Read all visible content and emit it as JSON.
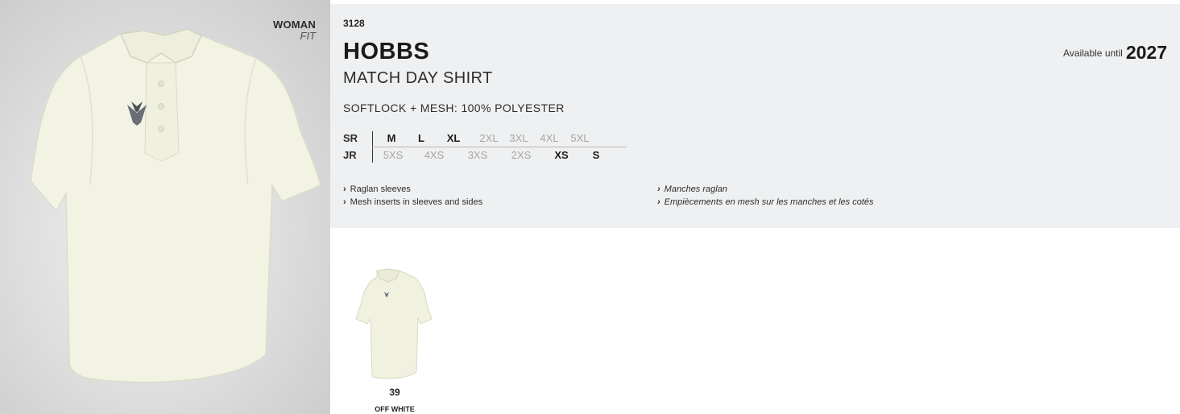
{
  "product": {
    "code": "3128",
    "name": "HOBBS",
    "subtitle": "MATCH DAY SHIRT",
    "material": "SOFTLOCK + MESH: 100% POLYESTER",
    "fit": {
      "gender": "WOMAN",
      "label": "FIT"
    },
    "availability": {
      "label": "Available until",
      "year": "2027"
    }
  },
  "sizes": {
    "senior": {
      "label": "SR",
      "items": [
        {
          "size": "M",
          "available": true
        },
        {
          "size": "L",
          "available": true
        },
        {
          "size": "XL",
          "available": true
        },
        {
          "size": "2XL",
          "available": false
        },
        {
          "size": "3XL",
          "available": false
        },
        {
          "size": "4XL",
          "available": false
        },
        {
          "size": "5XL",
          "available": false
        }
      ]
    },
    "junior": {
      "label": "JR",
      "items": [
        {
          "size": "5XS",
          "available": false
        },
        {
          "size": "4XS",
          "available": false
        },
        {
          "size": "3XS",
          "available": false
        },
        {
          "size": "2XS",
          "available": false
        },
        {
          "size": "XS",
          "available": true
        },
        {
          "size": "S",
          "available": true
        }
      ]
    }
  },
  "features": {
    "en": [
      "Raglan sleeves",
      "Mesh inserts in sleeves and sides"
    ],
    "fr": [
      "Manches raglan",
      "Empiècements en mesh sur les manches et les cotés"
    ]
  },
  "colors": [
    {
      "number": "39",
      "name": "OFF WHITE",
      "hex": "#f1f1df"
    }
  ],
  "brand_icon": "macron-logo-icon",
  "chevron_icon": "chevron-right-icon"
}
